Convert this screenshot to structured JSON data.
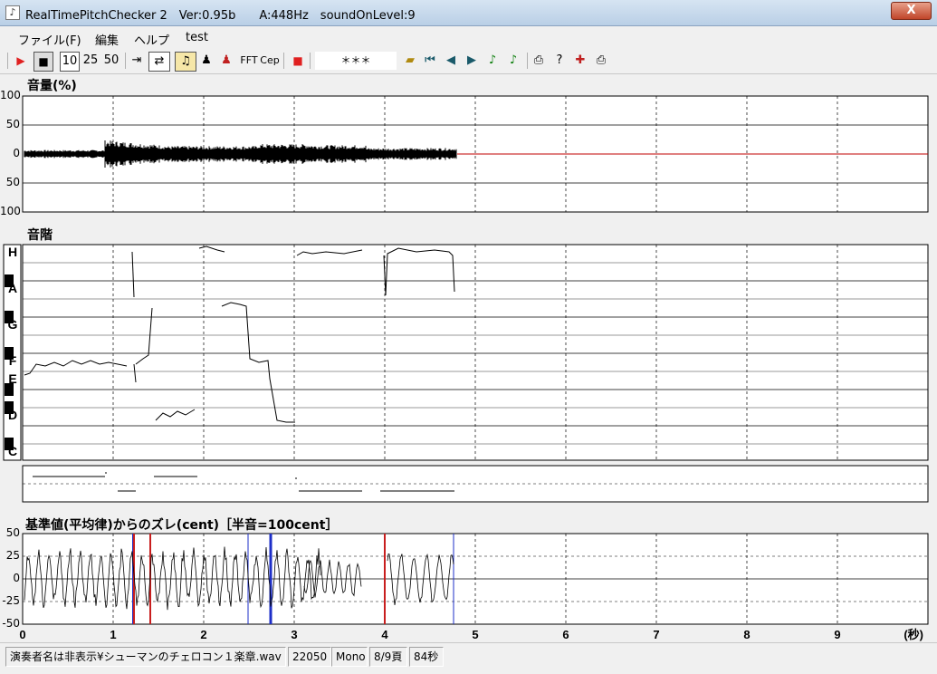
{
  "window": {
    "title": "RealTimePitchChecker 2　Ver:0.95b　　A:448Hz　soundOnLevel:9",
    "close_label": "X"
  },
  "menu": [
    "ファイル(F)",
    "編集",
    "ヘルプ",
    "test"
  ],
  "toolbar": {
    "speed_options": [
      "10",
      "25",
      "50"
    ],
    "fft_label": "FFT",
    "cep_label": "Cep",
    "display_value": "＊＊＊"
  },
  "volume_panel": {
    "title": "音量(%)",
    "y_ticks": [
      "100",
      "50",
      "0",
      "50",
      "100"
    ]
  },
  "scale_panel": {
    "title": "音階",
    "notes": [
      "H",
      "A",
      "G",
      "F",
      "E",
      "D",
      "C"
    ]
  },
  "deviation_panel": {
    "title": "基準値(平均律)からのズレ(cent)［半音=100cent］",
    "y_ticks": [
      "50",
      "25",
      "0",
      "-25",
      "-50"
    ]
  },
  "time_axis": {
    "ticks": [
      "0",
      "1",
      "2",
      "3",
      "4",
      "5",
      "6",
      "7",
      "8",
      "9"
    ],
    "unit": "(秒)"
  },
  "statusbar": {
    "filename": "演奏者名は非表示¥シューマンのチェロコン１楽章.wav",
    "rate": "22050",
    "channels": "Mono",
    "pages": "8/9頁",
    "seconds": "84秒"
  },
  "colors": {
    "play": "#e02020",
    "waveform": "#000000",
    "zero_line": "#c00000",
    "marker_blue": "#1e2fc8",
    "marker_red": "#c81e1e"
  }
}
